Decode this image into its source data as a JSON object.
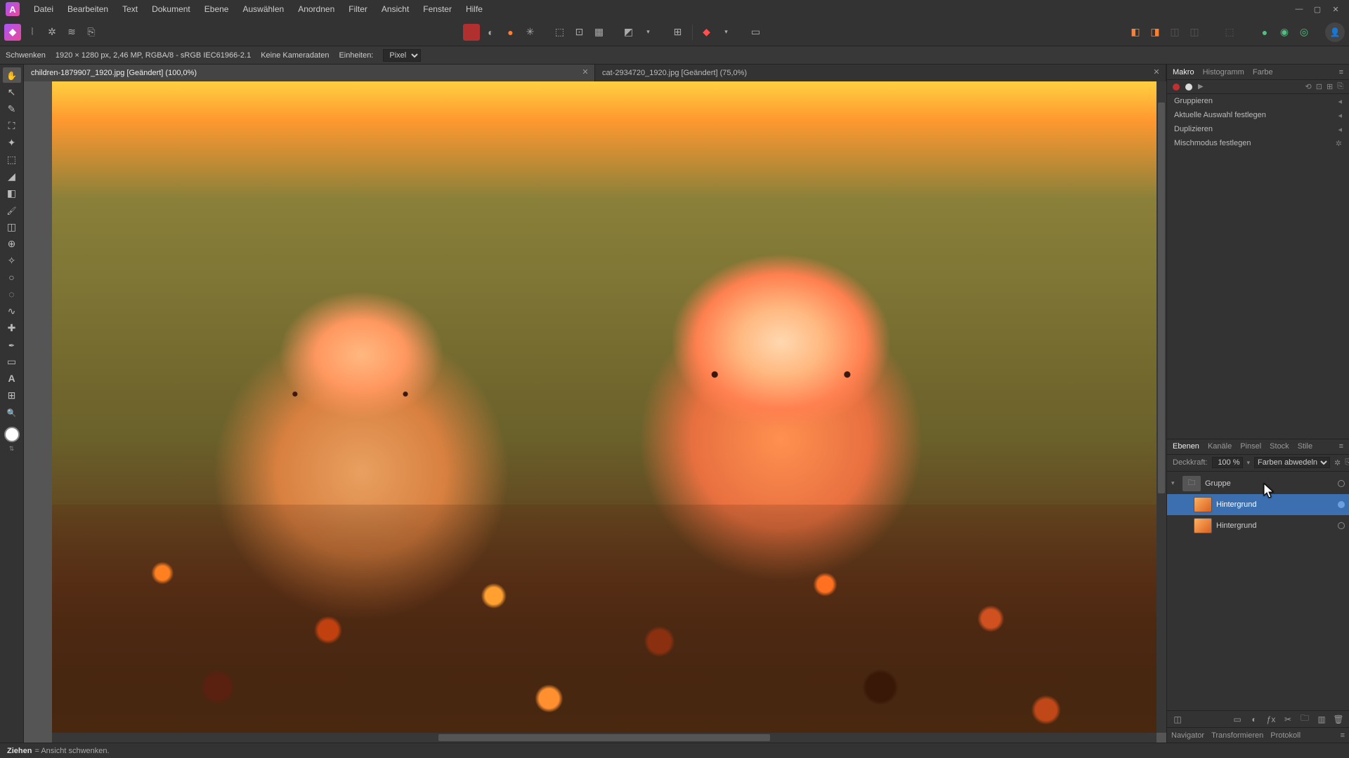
{
  "menu": [
    "Datei",
    "Bearbeiten",
    "Text",
    "Dokument",
    "Ebene",
    "Auswählen",
    "Anordnen",
    "Filter",
    "Ansicht",
    "Fenster",
    "Hilfe"
  ],
  "context": {
    "tool": "Schwenken",
    "docinfo": "1920 × 1280 px, 2,46 MP, RGBA/8 - sRGB IEC61966-2.1",
    "cam": "Keine Kameradaten",
    "units_label": "Einheiten:",
    "units_value": "Pixel"
  },
  "tabs": [
    {
      "label": "children-1879907_1920.jpg [Geändert] (100,0%)",
      "active": true
    },
    {
      "label": "cat-2934720_1920.jpg [Geändert] (75,0%)",
      "active": false
    }
  ],
  "right_top_tabs": [
    "Makro",
    "Histogramm",
    "Farbe"
  ],
  "macro_items": [
    "Gruppieren",
    "Aktuelle Auswahl festlegen",
    "Duplizieren",
    "Mischmodus festlegen"
  ],
  "layers_tabs": [
    "Ebenen",
    "Kanäle",
    "Pinsel",
    "Stock",
    "Stile"
  ],
  "opacity_label": "Deckkraft:",
  "opacity_value": "100 %",
  "blend_mode": "Farben abwedeln",
  "layers": [
    {
      "name": "Gruppe",
      "kind": "group",
      "selected": false,
      "indent": 0,
      "open": true
    },
    {
      "name": "Hintergrund",
      "kind": "pixel",
      "selected": true,
      "indent": 1
    },
    {
      "name": "Hintergrund",
      "kind": "pixel",
      "selected": false,
      "indent": 1
    }
  ],
  "nav_tabs": [
    "Navigator",
    "Transformieren",
    "Protokoll"
  ],
  "status_bold": "Ziehen",
  "status_text": " = Ansicht schwenken."
}
